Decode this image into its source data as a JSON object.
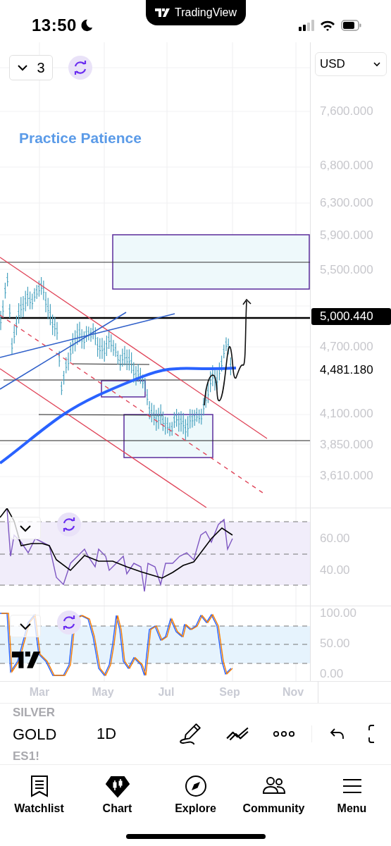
{
  "status_bar": {
    "time": "13:50",
    "banner_title": "TradingView"
  },
  "chart": {
    "layout_count": "3",
    "currency": "USD",
    "note": "Practice Patience",
    "price_axis": [
      "7,600.000",
      "6,800.000",
      "6,300.000",
      "5,900.000",
      "5,500.000",
      "4,700.000",
      "4,100.000",
      "3,850.000",
      "3,610.000"
    ],
    "price_tags": [
      {
        "label": "5,000.440",
        "kind": "highlight"
      },
      {
        "label": "4,481.180",
        "kind": "plain"
      }
    ]
  },
  "rsi_pane": {
    "axis": [
      "60.00",
      "40.00"
    ]
  },
  "stoch_pane": {
    "axis": [
      "100.00",
      "50.00",
      "0.00"
    ]
  },
  "time_axis": [
    "Mar",
    "May",
    "Jul",
    "Sep",
    "Nov"
  ],
  "symbol_bar": {
    "symbols": [
      {
        "label": "SILVER",
        "selected": false
      },
      {
        "label": "GOLD",
        "selected": true
      },
      {
        "label": "ES1!",
        "selected": false
      }
    ],
    "interval": "1D"
  },
  "tab_bar": [
    {
      "label": "Watchlist",
      "selected": false
    },
    {
      "label": "Chart",
      "selected": true
    },
    {
      "label": "Explore",
      "selected": false
    },
    {
      "label": "Community",
      "selected": false
    },
    {
      "label": "Menu",
      "selected": false
    }
  ]
}
